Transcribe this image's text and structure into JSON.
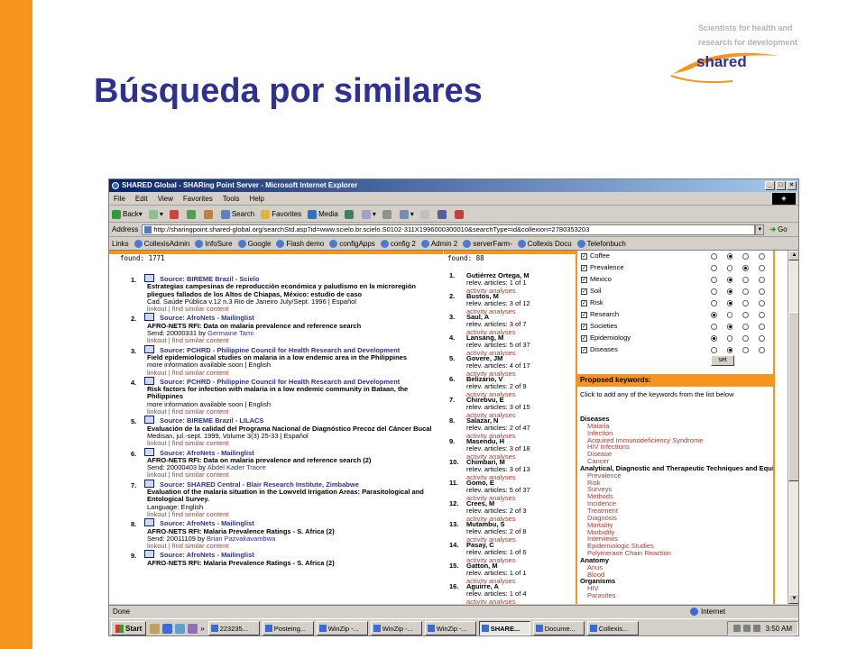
{
  "slide": {
    "title": "Búsqueda por similares",
    "logo": {
      "tagline_1": "Scientists for health and",
      "tagline_2": "research for development",
      "word": "shared"
    }
  },
  "browser": {
    "window_title": "SHARED Global - SHARing Point Server - Microsoft Internet Explorer",
    "menu": [
      "File",
      "Edit",
      "View",
      "Favorites",
      "Tools",
      "Help"
    ],
    "toolbar": {
      "back": "Back",
      "search": "Search",
      "favorites": "Favorites",
      "media": "Media"
    },
    "address_label": "Address",
    "address_url": "http://sharingpoint.shared-global.org/searchStd.asp?id=www.scielo.br.scielo.S0102-311X1996000300010&searchType=id&collexion=2780353203",
    "go_label": "Go",
    "links_label": "Links",
    "links": [
      "CollexisAdmin",
      "InfoSure",
      "Google",
      "Flash demo",
      "configApps",
      "config 2",
      "Admin 2",
      "serverFarm-",
      "Collexis Docu",
      "Telefonbuch"
    ],
    "status_text": "Done",
    "zone_text": "Internet"
  },
  "left": {
    "found": "found: 1771",
    "find_sep": "linkout | find similar content",
    "results": [
      {
        "num": "1.",
        "source": "Source: BIREME Brazil - Scielo",
        "title": "Estrategias campesinas de reproducción económica y paludismo en la microregión pliegues fallados de los Altos de Chiapas, México: estudio de caso",
        "info": "Cad. Saúde Pública v.12 n.3 Rio de Janeiro July/Sept. 1996 | Español",
        "by": ""
      },
      {
        "num": "2.",
        "source": "Source: AfroNets - Mailinglist",
        "title": "AFRO-NETS RFI: Data on malaria prevalence and reference search",
        "info": "Send: 20000331 by ",
        "by": "Germaine Tami"
      },
      {
        "num": "3.",
        "source": "Source: PCHRD - Philippine Council for Health Research and Development",
        "title": "Field epidemiological studies on malaria in a low endemic area in the Philippines",
        "info": "more information available soon | English",
        "by": ""
      },
      {
        "num": "4.",
        "source": "Source: PCHRD - Philippine Council for Health Research and Development",
        "title": "Risk factors for infection with malaria in a low endemic community in Bataan, the Philippines",
        "info": "more information available soon | English",
        "by": ""
      },
      {
        "num": "5.",
        "source": "Source: BIREME Brazil - LILACS",
        "title": "Evaluación de la calidad del Programa Nacional de Diagnóstico Precoz del Cáncer Bucal",
        "info": "Medisan, jul.-sept. 1999, Volume 3(3) 25-33 | Español",
        "by": ""
      },
      {
        "num": "6.",
        "source": "Source: AfroNets - Mailinglist",
        "title": "AFRO-NETS RFI: Data on malaria prevalence and reference search (2)",
        "info": "Send: 20000403 by ",
        "by": "Abdel Kader Traore"
      },
      {
        "num": "7.",
        "source": "Source: SHARED Central - Blair Research Institute, Zimbabwe",
        "title": "Evaluation of the malaria situation in the Lowveld Irrigation Areas: Parasitological and Entological Survey.",
        "info": "Language: English",
        "by": ""
      },
      {
        "num": "8.",
        "source": "Source: AfroNets - Mailinglist",
        "title": "AFRO-NETS RFI: Malaria Prevalence Ratings - S. Africa (2)",
        "info": "Send: 20011109 by ",
        "by": "Brian Pazvakavambwa"
      },
      {
        "num": "9.",
        "source": "Source: AfroNets - Mailinglist",
        "title": "AFRO-NETS RFI: Malaria Prevalence Ratings - S. Africa (2)",
        "info": "",
        "by": ""
      }
    ]
  },
  "middle": {
    "found": "found: 88",
    "activity": "activity analyses",
    "authors": [
      {
        "num": "1.",
        "name": "Gutiérrez Ortega, M",
        "rel": "relev. articles: 1 of 1"
      },
      {
        "num": "2.",
        "name": "Bustos, M",
        "rel": "relev. articles: 3 of 12"
      },
      {
        "num": "3.",
        "name": "Saul, A",
        "rel": "relev. articles: 3 of 7"
      },
      {
        "num": "4.",
        "name": "Lansang, M",
        "rel": "relev. articles: 5 of 37"
      },
      {
        "num": "5.",
        "name": "Govere, JM",
        "rel": "relev. articles: 4 of 17"
      },
      {
        "num": "6.",
        "name": "Belizario, V",
        "rel": "relev. articles: 2 of 9"
      },
      {
        "num": "7.",
        "name": "Chirebvu, E",
        "rel": "relev. articles: 3 of 15"
      },
      {
        "num": "8.",
        "name": "Salazar, N",
        "rel": "relev. articles: 2 of 47"
      },
      {
        "num": "9.",
        "name": "Masendu, H",
        "rel": "relev. articles: 3 of 18"
      },
      {
        "num": "10.",
        "name": "Chimbari, M",
        "rel": "relev. articles: 3 of 13"
      },
      {
        "num": "11.",
        "name": "Gomo, E",
        "rel": "relev. articles: 5 of 37"
      },
      {
        "num": "12.",
        "name": "Crees, M",
        "rel": "relev. articles: 2 of 3"
      },
      {
        "num": "13.",
        "name": "Mutambu, S",
        "rel": "relev. articles: 2 of 8"
      },
      {
        "num": "14.",
        "name": "Pasay, C",
        "rel": "relev. articles: 1 of 6"
      },
      {
        "num": "15.",
        "name": "Gatton, M",
        "rel": "relev. articles: 1 of 1"
      },
      {
        "num": "16.",
        "name": "Aguirre, A",
        "rel": "relev. articles: 1 of 4"
      }
    ]
  },
  "right": {
    "keywords": [
      {
        "name": "Coffee",
        "sel": 1
      },
      {
        "name": "Prevalence",
        "sel": 2
      },
      {
        "name": "Mexico",
        "sel": 1
      },
      {
        "name": "Soil",
        "sel": 1
      },
      {
        "name": "Risk",
        "sel": 1
      },
      {
        "name": "Research",
        "sel": 0
      },
      {
        "name": "Societies",
        "sel": 1
      },
      {
        "name": "Epidemiology",
        "sel": 0
      },
      {
        "name": "Diseases",
        "sel": 1
      }
    ],
    "set_label": "set",
    "proposed_title": "Proposed keywords:",
    "intro": "Click to add any of the keywords from the list below",
    "groups": [
      {
        "cat": "Diseases",
        "items": [
          "Malaria",
          "Infection",
          "Acquired Immunodeficiency Syndrome",
          "HIV Infections",
          "Disease",
          "Cancer"
        ]
      },
      {
        "cat": "Analytical, Diagnostic and Therapeutic Techniques and Equipment",
        "items": [
          "Prevalence",
          "Risk",
          "Surveys",
          "Methods",
          "Incidence",
          "Treatment",
          "Diagnosis",
          "Mortality",
          "Morbidity",
          "Interviews",
          "Epidemiologic Studies",
          "Polymerase Chain Reaction"
        ]
      },
      {
        "cat": "Anatomy",
        "items": [
          "Anus",
          "Blood"
        ]
      },
      {
        "cat": "Organisms",
        "items": [
          "HIV",
          "Parasites"
        ]
      }
    ]
  },
  "taskbar": {
    "start": "Start",
    "tasks": [
      "223235...",
      "Posteing...",
      "WinZip -...",
      "WinZip -...",
      "WinZip -...",
      "SHARE...",
      "Docume...",
      "Collexis..."
    ],
    "active_index": 5,
    "clock": "3:50 AM"
  }
}
